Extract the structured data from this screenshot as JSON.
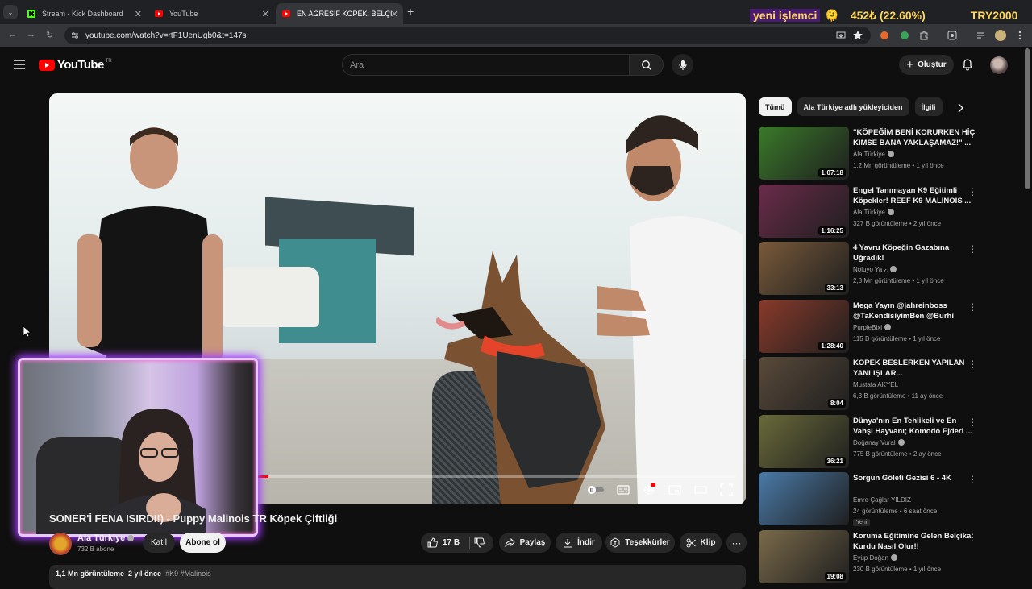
{
  "browser": {
    "tabs": [
      {
        "label": "Stream - Kick Dashboard",
        "favicon": "kick-icon",
        "active": false
      },
      {
        "label": "YouTube",
        "favicon": "youtube-icon",
        "active": false
      },
      {
        "label": "EN AGRESİF KÖPEK: BELÇİKA M",
        "favicon": "youtube-icon",
        "active": true
      }
    ],
    "url": "youtube.com/watch?v=rtF1UenUgb0&t=147s"
  },
  "overlay": {
    "label": "yeni işlemci",
    "emoji": "🫠",
    "value": "452₺ (22.60%)",
    "target": "TRY2000"
  },
  "header": {
    "logo_text": "YouTube",
    "country_code": "TR",
    "search_placeholder": "Ara",
    "create_label": "Oluştur"
  },
  "player": {
    "progress_fraction": 0.31
  },
  "video": {
    "title": "SONER'İ FENA ISIRDI!) - Puppy Malinois TR Köpek Çiftliği",
    "channel": "Ala Türkiye",
    "subscribers": "732 B abone",
    "join_label": "Katıl",
    "subscribe_label": "Abone ol",
    "likes": "17 B",
    "share_label": "Paylaş",
    "download_label": "İndir",
    "thanks_label": "Teşekkürler",
    "clip_label": "Klip",
    "more_label": "···",
    "views": "1,1 Mn görüntüleme",
    "date": "2 yıl önce",
    "tags": "#K9 #Malinois"
  },
  "chips": [
    "Tümü",
    "Ala Türkiye adlı yükleyiciden",
    "İlgili"
  ],
  "recommendations": [
    {
      "title": "\"KÖPEĞİM BENİ KORURKEN HİÇ KİMSE BANA YAKLAŞAMAZ!\" ...",
      "channel": "Ala Türkiye",
      "verified": true,
      "meta": "1,2 Mn görüntüleme • 1 yıl önce",
      "duration": "1:07:18",
      "thumb_color": "#3a7a2a",
      "badge": ""
    },
    {
      "title": "Engel Tanımayan K9 Eğitimli Köpekler! REEF K9 MALİNOİS ...",
      "channel": "Ala Türkiye",
      "verified": true,
      "meta": "327 B görüntüleme • 2 yıl önce",
      "duration": "1:16:25",
      "thumb_color": "#6b2b4a",
      "badge": ""
    },
    {
      "title": "4 Yavru Köpeğin Gazabına Uğradık!",
      "channel": "Noluyo Ya ¿",
      "verified": true,
      "meta": "2,8 Mn görüntüleme • 1 yıl önce",
      "duration": "33:13",
      "thumb_color": "#7a5a3a",
      "badge": ""
    },
    {
      "title": "Mega Yayın @jahreinboss @TaKendisiyimBen @Burhi",
      "channel": "PurpleBixi",
      "verified": true,
      "meta": "115 B görüntüleme • 1 yıl önce",
      "duration": "1:28:40",
      "thumb_color": "#8a3a2a",
      "badge": ""
    },
    {
      "title": "KÖPEK BESLERKEN YAPILAN YANLIŞLAR...",
      "channel": "Mustafa AKYEL",
      "verified": false,
      "meta": "6,3 B görüntüleme • 11 ay önce",
      "duration": "8:04",
      "thumb_color": "#5a4a3a",
      "badge": ""
    },
    {
      "title": "Dünya'nın En Tehlikeli ve En Vahşi Hayvanı; Komodo Ejderi ...",
      "channel": "Doğanay Vural",
      "verified": true,
      "meta": "775 B görüntüleme • 2 ay önce",
      "duration": "36:21",
      "thumb_color": "#6a6a3a",
      "badge": ""
    },
    {
      "title": "Sorgun Göleti Gezisi 6 - 4K",
      "channel": "Emre Çağlar YILDIZ",
      "verified": false,
      "meta": "24 görüntüleme • 6 saat önce",
      "duration": "",
      "thumb_color": "#4a7aa8",
      "badge": "Yeni"
    },
    {
      "title": "Koruma Eğitimine Gelen Belçika Kurdu Nasıl Olur!!",
      "channel": "Eyüp Doğan",
      "verified": true,
      "meta": "230 B görüntüleme • 1 yıl önce",
      "duration": "19:08",
      "thumb_color": "#7a6a4a",
      "badge": ""
    }
  ]
}
